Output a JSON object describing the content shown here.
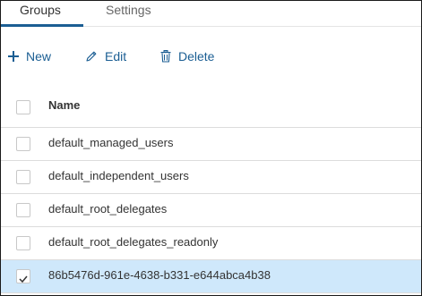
{
  "tabs": [
    {
      "label": "Groups",
      "active": true
    },
    {
      "label": "Settings",
      "active": false
    }
  ],
  "toolbar": {
    "new_label": "New",
    "edit_label": "Edit",
    "delete_label": "Delete"
  },
  "table": {
    "columns": [
      "Name"
    ],
    "rows": [
      {
        "name": "default_managed_users",
        "checked": false
      },
      {
        "name": "default_independent_users",
        "checked": false
      },
      {
        "name": "default_root_delegates",
        "checked": false
      },
      {
        "name": "default_root_delegates_readonly",
        "checked": false
      },
      {
        "name": "86b5476d-961e-4638-b331-e644abca4b38",
        "checked": true
      }
    ]
  },
  "colors": {
    "accent": "#1b5e93",
    "selected_row": "#cfe8fb",
    "text": "#333333"
  }
}
